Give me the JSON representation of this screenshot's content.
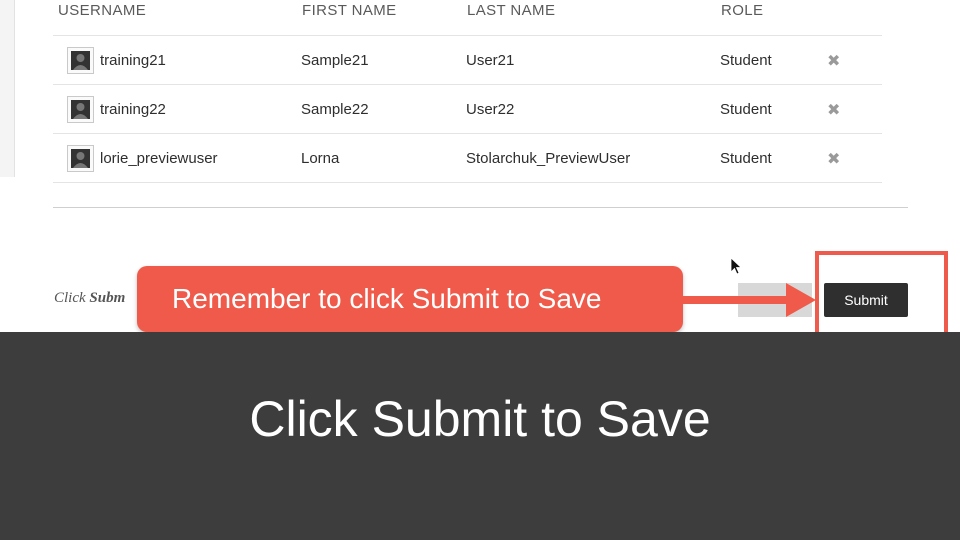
{
  "table": {
    "headers": [
      "USERNAME",
      "FIRST NAME",
      "LAST NAME",
      "ROLE"
    ],
    "rows": [
      {
        "username": "training21",
        "first": "Sample21",
        "last": "User21",
        "role": "Student"
      },
      {
        "username": "training22",
        "first": "Sample22",
        "last": "User22",
        "role": "Student"
      },
      {
        "username": "lorie_previewuser",
        "first": "Lorna",
        "last": "Stolarchuk_PreviewUser",
        "role": "Student"
      }
    ],
    "remove_icon": "✖"
  },
  "footer": {
    "hint_prefix": "Click",
    "hint_bold": "Subm",
    "submit_label": "Submit"
  },
  "callout": {
    "text": "Remember to click Submit to Save",
    "color": "#f05a4a"
  },
  "overlay": {
    "title": "Click Submit to Save"
  },
  "colors": {
    "overlay_bg": "#3d3d3d",
    "highlight": "#ee5a4b",
    "button_bg": "#2f2f2f"
  }
}
